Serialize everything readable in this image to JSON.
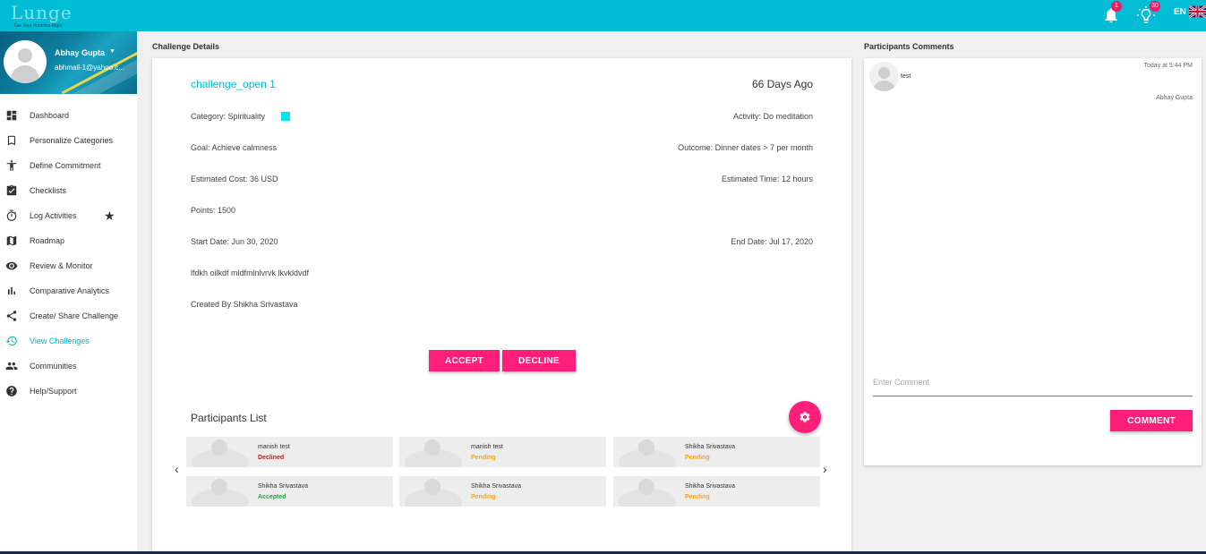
{
  "header": {
    "logo_text": "Lunge",
    "logo_tagline": "Get Your Priorities Right",
    "notifications_badge": "1",
    "ideas_badge": "30",
    "language": "EN"
  },
  "sidebar": {
    "user_name": "Abhay Gupta",
    "user_email": "abhmail-1@yahoo.c...",
    "items": [
      {
        "label": "Dashboard",
        "icon": "dashboard-icon"
      },
      {
        "label": "Personalize Categories",
        "icon": "bookmark-icon"
      },
      {
        "label": "Define Commitment",
        "icon": "person-icon"
      },
      {
        "label": "Checklists",
        "icon": "clipboard-check-icon"
      },
      {
        "label": "Log Activities",
        "icon": "timer-icon"
      },
      {
        "label": "Roadmap",
        "icon": "map-icon"
      },
      {
        "label": "Review & Monitor",
        "icon": "eye-icon"
      },
      {
        "label": "Comparative Analytics",
        "icon": "bar-chart-icon"
      },
      {
        "label": "Create/ Share Challenge",
        "icon": "share-icon"
      },
      {
        "label": "View Challenges",
        "icon": "history-icon",
        "active": true
      },
      {
        "label": "Communities",
        "icon": "people-icon"
      },
      {
        "label": "Help/Support",
        "icon": "help-icon"
      }
    ]
  },
  "challenge": {
    "section_title": "Challenge Details",
    "title": "challenge_open 1",
    "age": "66 Days Ago",
    "category": "Category: Spirituality",
    "category_color": "#00e5ee",
    "activity": "Activity: Do meditation",
    "goal": "Goal: Achieve calmness",
    "outcome": "Outcome: Dinner dates > 7 per month",
    "cost": "Estimated Cost: 36 USD",
    "time": "Estimated Time: 12 hours",
    "points": "Points: 1500",
    "start_date": "Start Date: Jun 30, 2020",
    "end_date": "End Date: Jul 17, 2020",
    "description": "lfdkh oilkdf mldfmlnlvrvk lkvkldvdf",
    "created_by": "Created By Shikha Srivastava",
    "accept_label": "ACCEPT",
    "decline_label": "DECLINE"
  },
  "participants": {
    "title": "Participants List",
    "prev_arrow": "‹",
    "next_arrow": "›",
    "items": [
      {
        "name": "manish test",
        "status": "Declined",
        "status_color": "#b71c1c"
      },
      {
        "name": "manish test",
        "status": "Pending",
        "status_color": "#f5a623"
      },
      {
        "name": "Shikha Srivastava",
        "status": "Pending",
        "status_color": "#f5a623"
      },
      {
        "name": "Shikha Srivastava",
        "status": "Accepted",
        "status_color": "#2e9e3e"
      },
      {
        "name": "Shikha Srivastava",
        "status": "Pending",
        "status_color": "#f5a623"
      },
      {
        "name": "Shikha Srivastava",
        "status": "Pending",
        "status_color": "#f5a623"
      }
    ]
  },
  "comments": {
    "section_title": "Participants Comments",
    "items": [
      {
        "text": "test",
        "time": "Today at 5:44 PM",
        "author": "Abhay Gupta"
      }
    ],
    "input_placeholder": "Enter Comment",
    "submit_label": "COMMENT"
  },
  "colors": {
    "topbar": "#00bcd4",
    "accent": "#ff1f7a",
    "active_nav": "#00bcd4"
  }
}
